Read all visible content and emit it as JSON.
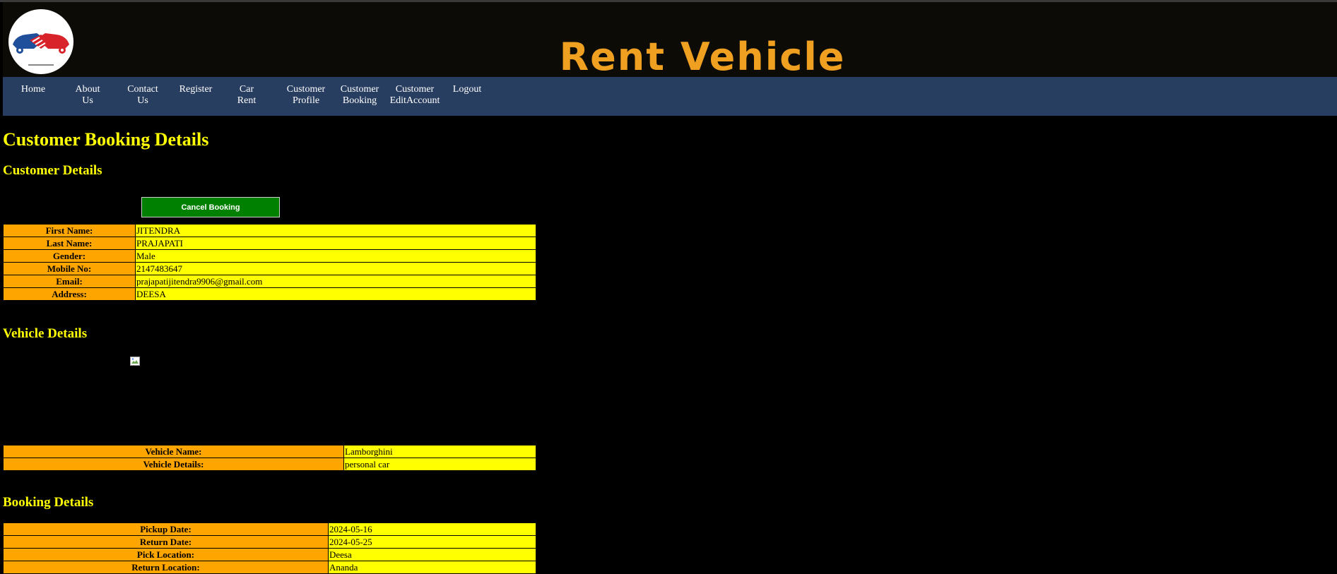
{
  "header": {
    "title": "Rent Vehicle"
  },
  "nav": [
    {
      "label": "Home"
    },
    {
      "label": "About Us"
    },
    {
      "label": "Contact Us"
    },
    {
      "label": "Register"
    },
    {
      "label": "Car Rent"
    },
    {
      "label": "Customer Profile"
    },
    {
      "label": "Customer Booking"
    },
    {
      "label": "Customer EditAccount"
    },
    {
      "label": "Logout"
    }
  ],
  "page_title": "Customer Booking Details",
  "customer": {
    "heading": "Customer Details",
    "cancel_label": "Cancel Booking",
    "rows": [
      {
        "label": "First Name:",
        "value": "JITENDRA"
      },
      {
        "label": "Last Name:",
        "value": "PRAJAPATI"
      },
      {
        "label": "Gender:",
        "value": "Male"
      },
      {
        "label": "Mobile No:",
        "value": "2147483647"
      },
      {
        "label": "Email:",
        "value": "prajapatijitendra9906@gmail.com"
      },
      {
        "label": "Address:",
        "value": "DEESA"
      }
    ]
  },
  "vehicle": {
    "heading": "Vehicle Details",
    "rows": [
      {
        "label": "Vehicle Name:",
        "value": "Lamborghini"
      },
      {
        "label": "Vehicle Details:",
        "value": "personal car"
      }
    ]
  },
  "booking": {
    "heading": "Booking Details",
    "rows": [
      {
        "label": "Pickup Date:",
        "value": "2024-05-16"
      },
      {
        "label": "Return Date:",
        "value": "2024-05-25"
      },
      {
        "label": "Pick Location:",
        "value": "Deesa"
      },
      {
        "label": "Return Location:",
        "value": "Ananda"
      }
    ]
  },
  "colors": {
    "brand_orange": "#f0a020",
    "nav_bg": "#283e61",
    "heading_yellow": "#ffff00",
    "label_orange": "#ffa500",
    "button_green": "#008000"
  }
}
